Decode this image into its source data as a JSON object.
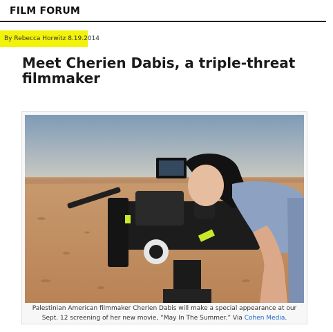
{
  "section": {
    "title": "FILM FORUM"
  },
  "byline": {
    "text": "By Rebecca Horwitz 8.19.2014"
  },
  "article": {
    "headline": "Meet Cherien Dabis, a triple-threat filmmaker"
  },
  "figure": {
    "image_alt": "Cherien Dabis looking through a film camera in the desert",
    "caption_text": "Palestinian American filmmaker Cherien Dabis will make a special appearance at our Sept. 12 screening of her new movie, “May In The Summer.” Via ",
    "caption_link": "Cohen Media",
    "caption_end": "."
  },
  "colors": {
    "highlight": "#f2f20a",
    "link": "#1a66cc",
    "rule": "#222222"
  }
}
